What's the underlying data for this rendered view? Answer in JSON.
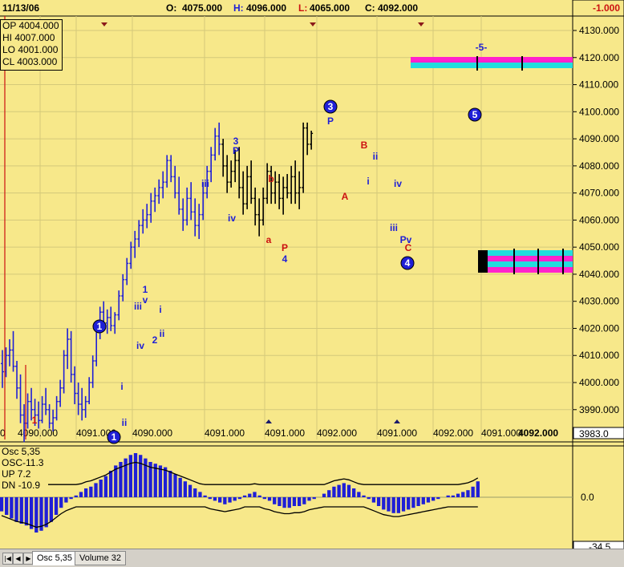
{
  "header": {
    "date": "11/13/06",
    "open_label": "O:",
    "open": "4075.000",
    "high_label": "H:",
    "high": "4096.000",
    "low_label": "L:",
    "low": "4065.000",
    "close_label": "C:",
    "close": "4092.000",
    "change": "-1.000"
  },
  "ohlc_box": {
    "op": "OP 4004.000",
    "hi": "HI  4007.000",
    "lo": "LO  4001.000",
    "cl": "CL  4003.000"
  },
  "osc_box": {
    "title": "Osc 5,35",
    "osc": "OSC-11.3",
    "up": "UP   7.2",
    "dn": "DN   -10.9"
  },
  "price_axis": {
    "ticks": [
      "4130.000",
      "4120.000",
      "4110.000",
      "4100.000",
      "4090.000",
      "4080.000",
      "4070.000",
      "4060.000",
      "4050.000",
      "4040.000",
      "4030.000",
      "4020.000",
      "4010.000",
      "4000.000",
      "3990.000"
    ],
    "last_value": "3983.0"
  },
  "bottom_axis_labels": [
    "0",
    "4090.000",
    "4091.000",
    "4090.000",
    "4091.000",
    "4091.000",
    "4092.000",
    "4091.000",
    "4092.000",
    "4091.000"
  ],
  "bottom_axis_last": "4092.000",
  "osc_axis": {
    "zero_label": "0.0",
    "min_label": "-34.5"
  },
  "tabs": {
    "tab1": "Osc 5,35",
    "tab2": "Volume 32"
  },
  "colors": {
    "background": "#f7e88a",
    "bars_blue": "#1f1fd6",
    "bars_black": "#000000",
    "label_red": "#cc1111",
    "label_blue": "#1f1fd6",
    "magenta": "#ff22cc",
    "cyan": "#22dddd",
    "grid": "#d4c97a"
  },
  "chart_data": {
    "type": "bar",
    "title": "",
    "ylim": [
      3983,
      4135
    ],
    "x_labels": [
      "4090.000",
      "4091.000",
      "4090.000",
      "4091.000",
      "4091.000",
      "4092.000",
      "4091.000",
      "4092.000",
      "4091.000"
    ],
    "series": [
      {
        "color": "blue",
        "values": [
          {
            "o": 4007,
            "h": 4012,
            "l": 3998,
            "c": 4004
          },
          {
            "o": 4004,
            "h": 4013,
            "l": 4002,
            "c": 4010
          },
          {
            "o": 4010,
            "h": 4016,
            "l": 4006,
            "c": 4012
          },
          {
            "o": 4012,
            "h": 4019,
            "l": 4004,
            "c": 4006
          },
          {
            "o": 4006,
            "h": 4008,
            "l": 3994,
            "c": 3998
          },
          {
            "o": 3998,
            "h": 4003,
            "l": 3985,
            "c": 3988
          },
          {
            "o": 3988,
            "h": 3992,
            "l": 3978,
            "c": 3985
          },
          {
            "o": 3985,
            "h": 3996,
            "l": 3983,
            "c": 3993
          },
          {
            "o": 3993,
            "h": 3998,
            "l": 3986,
            "c": 3990
          },
          {
            "o": 3990,
            "h": 3994,
            "l": 3984,
            "c": 3988
          },
          {
            "o": 3988,
            "h": 3993,
            "l": 3983,
            "c": 3986
          },
          {
            "o": 3986,
            "h": 3995,
            "l": 3985,
            "c": 3992
          },
          {
            "o": 3992,
            "h": 3998,
            "l": 3988,
            "c": 3990
          },
          {
            "o": 3990,
            "h": 3992,
            "l": 3983,
            "c": 3985
          },
          {
            "o": 3985,
            "h": 3990,
            "l": 3982,
            "c": 3987
          },
          {
            "o": 3987,
            "h": 3995,
            "l": 3986,
            "c": 3993
          },
          {
            "o": 3993,
            "h": 4001,
            "l": 3991,
            "c": 3998
          },
          {
            "o": 3998,
            "h": 4012,
            "l": 3996,
            "c": 4010
          },
          {
            "o": 4010,
            "h": 4020,
            "l": 4005,
            "c": 4016
          },
          {
            "o": 4016,
            "h": 4019,
            "l": 4000,
            "c": 4003
          },
          {
            "o": 4003,
            "h": 4006,
            "l": 3992,
            "c": 3996
          },
          {
            "o": 3996,
            "h": 4000,
            "l": 3988,
            "c": 3992
          },
          {
            "o": 3992,
            "h": 3998,
            "l": 3986,
            "c": 3990
          },
          {
            "o": 3990,
            "h": 3995,
            "l": 3987,
            "c": 3993
          },
          {
            "o": 3993,
            "h": 4002,
            "l": 3992,
            "c": 4000
          },
          {
            "o": 4000,
            "h": 4010,
            "l": 3998,
            "c": 4008
          },
          {
            "o": 4008,
            "h": 4022,
            "l": 4006,
            "c": 4020
          },
          {
            "o": 4020,
            "h": 4028,
            "l": 4016,
            "c": 4026
          },
          {
            "o": 4026,
            "h": 4030,
            "l": 4020,
            "c": 4022
          },
          {
            "o": 4022,
            "h": 4027,
            "l": 4018,
            "c": 4024
          },
          {
            "o": 4024,
            "h": 4028,
            "l": 4019,
            "c": 4021
          },
          {
            "o": 4021,
            "h": 4026,
            "l": 4018,
            "c": 4025
          },
          {
            "o": 4025,
            "h": 4034,
            "l": 4023,
            "c": 4032
          },
          {
            "o": 4032,
            "h": 4040,
            "l": 4030,
            "c": 4038
          },
          {
            "o": 4038,
            "h": 4046,
            "l": 4036,
            "c": 4044
          },
          {
            "o": 4044,
            "h": 4052,
            "l": 4042,
            "c": 4050
          },
          {
            "o": 4050,
            "h": 4056,
            "l": 4046,
            "c": 4053
          },
          {
            "o": 4053,
            "h": 4060,
            "l": 4050,
            "c": 4058
          },
          {
            "o": 4058,
            "h": 4064,
            "l": 4055,
            "c": 4060
          },
          {
            "o": 4060,
            "h": 4066,
            "l": 4057,
            "c": 4062
          },
          {
            "o": 4062,
            "h": 4070,
            "l": 4059,
            "c": 4067
          },
          {
            "o": 4067,
            "h": 4072,
            "l": 4063,
            "c": 4069
          },
          {
            "o": 4069,
            "h": 4075,
            "l": 4066,
            "c": 4072
          },
          {
            "o": 4072,
            "h": 4078,
            "l": 4068,
            "c": 4074
          },
          {
            "o": 4074,
            "h": 4084,
            "l": 4072,
            "c": 4082
          },
          {
            "o": 4082,
            "h": 4084,
            "l": 4074,
            "c": 4076
          },
          {
            "o": 4076,
            "h": 4080,
            "l": 4068,
            "c": 4070
          },
          {
            "o": 4070,
            "h": 4076,
            "l": 4062,
            "c": 4064
          },
          {
            "o": 4064,
            "h": 4068,
            "l": 4056,
            "c": 4060
          },
          {
            "o": 4060,
            "h": 4072,
            "l": 4058,
            "c": 4068
          },
          {
            "o": 4068,
            "h": 4074,
            "l": 4060,
            "c": 4063
          },
          {
            "o": 4063,
            "h": 4068,
            "l": 4054,
            "c": 4058
          },
          {
            "o": 4058,
            "h": 4066,
            "l": 4053,
            "c": 4062
          },
          {
            "o": 4062,
            "h": 4074,
            "l": 4060,
            "c": 4070
          },
          {
            "o": 4070,
            "h": 4080,
            "l": 4068,
            "c": 4078
          },
          {
            "o": 4078,
            "h": 4087,
            "l": 4074,
            "c": 4084
          },
          {
            "o": 4084,
            "h": 4094,
            "l": 4082,
            "c": 4091
          },
          {
            "o": 4091,
            "h": 4096,
            "l": 4084,
            "c": 4088
          }
        ]
      },
      {
        "color": "black",
        "values": [
          {
            "o": 4088,
            "h": 4090,
            "l": 4076,
            "c": 4080
          },
          {
            "o": 4080,
            "h": 4084,
            "l": 4070,
            "c": 4074
          },
          {
            "o": 4074,
            "h": 4082,
            "l": 4072,
            "c": 4078
          },
          {
            "o": 4078,
            "h": 4086,
            "l": 4074,
            "c": 4082
          },
          {
            "o": 4082,
            "h": 4087,
            "l": 4068,
            "c": 4072
          },
          {
            "o": 4072,
            "h": 4078,
            "l": 4062,
            "c": 4066
          },
          {
            "o": 4066,
            "h": 4080,
            "l": 4064,
            "c": 4076
          },
          {
            "o": 4076,
            "h": 4082,
            "l": 4066,
            "c": 4068
          },
          {
            "o": 4068,
            "h": 4072,
            "l": 4058,
            "c": 4062
          },
          {
            "o": 4062,
            "h": 4068,
            "l": 4054,
            "c": 4060
          },
          {
            "o": 4060,
            "h": 4072,
            "l": 4058,
            "c": 4068
          },
          {
            "o": 4068,
            "h": 4081,
            "l": 4066,
            "c": 4078
          },
          {
            "o": 4078,
            "h": 4080,
            "l": 4066,
            "c": 4070
          },
          {
            "o": 4070,
            "h": 4078,
            "l": 4066,
            "c": 4074
          },
          {
            "o": 4074,
            "h": 4077,
            "l": 4064,
            "c": 4068
          },
          {
            "o": 4068,
            "h": 4076,
            "l": 4062,
            "c": 4072
          },
          {
            "o": 4072,
            "h": 4077,
            "l": 4068,
            "c": 4070
          },
          {
            "o": 4070,
            "h": 4080,
            "l": 4066,
            "c": 4076
          },
          {
            "o": 4076,
            "h": 4082,
            "l": 4066,
            "c": 4070
          },
          {
            "o": 4070,
            "h": 4078,
            "l": 4064,
            "c": 4072
          },
          {
            "o": 4072,
            "h": 4096,
            "l": 4070,
            "c": 4094
          },
          {
            "o": 4094,
            "h": 4096,
            "l": 4084,
            "c": 4088
          },
          {
            "o": 4088,
            "h": 4093,
            "l": 4086,
            "c": 4092
          }
        ]
      }
    ],
    "annotations": [
      {
        "text": "1",
        "color": "blue",
        "type": "circle"
      },
      {
        "text": "3",
        "color": "blue",
        "type": "circle"
      },
      {
        "text": "4",
        "color": "blue",
        "type": "circle"
      },
      {
        "text": "5",
        "color": "blue",
        "type": "circle"
      },
      {
        "text": "-5-",
        "color": "blue",
        "type": "label"
      },
      {
        "text": "A",
        "color": "red",
        "type": "label"
      },
      {
        "text": "B",
        "color": "red",
        "type": "label"
      },
      {
        "text": "C",
        "color": "red",
        "type": "label"
      },
      {
        "text": "a",
        "color": "red",
        "type": "label"
      },
      {
        "text": "b",
        "color": "red",
        "type": "label"
      },
      {
        "text": "iii",
        "color": "blue",
        "type": "label"
      },
      {
        "text": "iv",
        "color": "blue",
        "type": "label"
      },
      {
        "text": "ii",
        "color": "blue",
        "type": "label"
      },
      {
        "text": "i",
        "color": "blue",
        "type": "label"
      }
    ],
    "target_bands": [
      {
        "price": 4120,
        "colors": [
          "magenta",
          "cyan"
        ]
      },
      {
        "price": 4048,
        "colors": [
          "cyan",
          "magenta",
          "cyan",
          "magenta"
        ]
      }
    ],
    "oscillator": {
      "name": "Osc 5,35",
      "values": [
        -8,
        -10,
        -12,
        -14,
        -15,
        -16,
        -18,
        -20,
        -19,
        -17,
        -14,
        -10,
        -6,
        -3,
        -1,
        1,
        3,
        5,
        6,
        8,
        10,
        12,
        15,
        18,
        20,
        22,
        24,
        25,
        24,
        22,
        20,
        19,
        18,
        17,
        15,
        13,
        11,
        9,
        7,
        5,
        3,
        1,
        -1,
        -2,
        -3,
        -4,
        -3,
        -2,
        -1,
        1,
        2,
        3,
        1,
        -1,
        -2,
        -4,
        -5,
        -6,
        -6,
        -5,
        -5,
        -4,
        -2,
        -1,
        0,
        2,
        4,
        6,
        7,
        8,
        7,
        5,
        3,
        1,
        -1,
        -3,
        -5,
        -7,
        -8,
        -9,
        -9,
        -8,
        -7,
        -6,
        -5,
        -4,
        -3,
        -2,
        -1,
        0,
        1,
        1,
        2,
        3,
        4,
        6,
        9
      ],
      "upper": 7.2,
      "lower": -10.9,
      "ylim": [
        -34.5,
        30
      ]
    }
  }
}
